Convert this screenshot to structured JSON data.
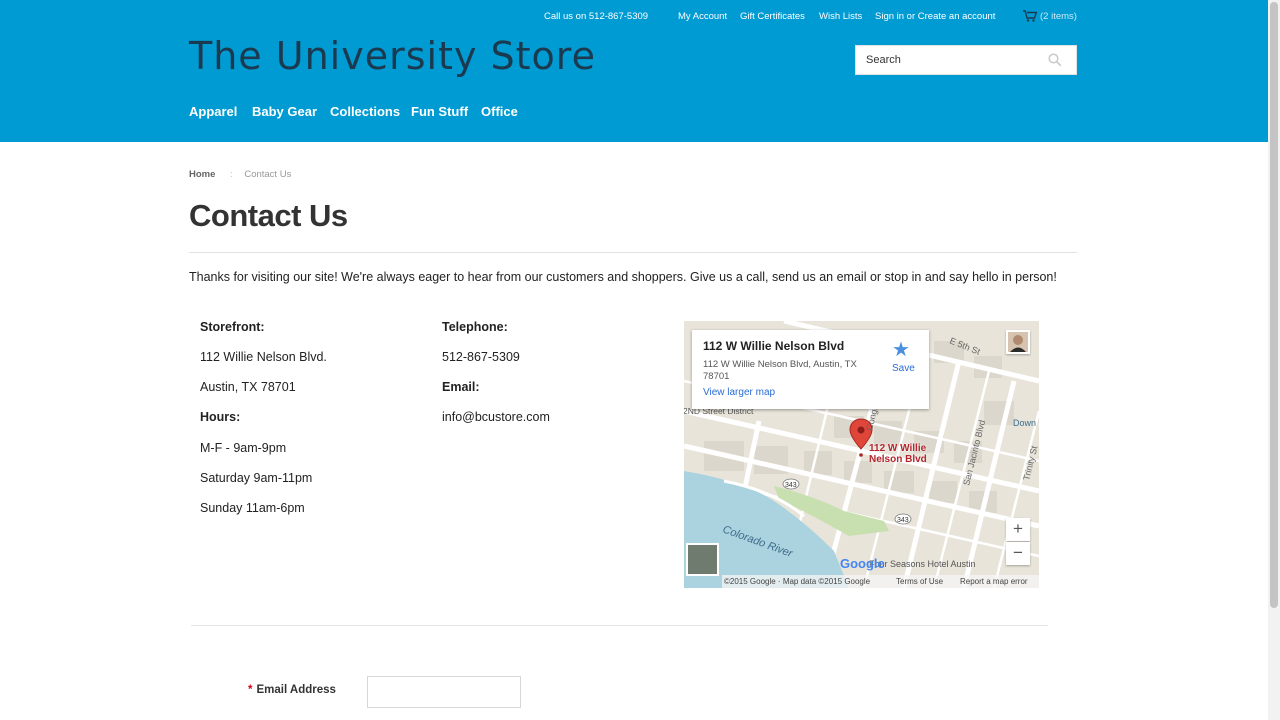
{
  "topbar": {
    "phone": "Call us on 512-867-5309",
    "my_account": "My Account",
    "gift_certificates": "Gift Certificates",
    "wish_lists": "Wish Lists",
    "sign_in": "Sign in or Create an account",
    "cart_count": "(2 items)"
  },
  "header": {
    "store_name": "The University Store",
    "search_placeholder": "Search"
  },
  "nav": [
    "Apparel",
    "Baby Gear",
    "Collections",
    "Fun Stuff",
    "Office"
  ],
  "breadcrumb": {
    "home": "Home",
    "separator": ":",
    "current": "Contact Us"
  },
  "page": {
    "title": "Contact Us",
    "intro": "Thanks for visiting our site! We're always eager to hear from our customers and shoppers. Give us a call, send us an email or stop in and say hello in person!"
  },
  "storefront": {
    "heading": "Storefront:",
    "address1": "112 Willie Nelson Blvd.",
    "address2": "Austin, TX 78701",
    "hours_heading": "Hours:",
    "hours": [
      "M-F - 9am-9pm",
      "Saturday 9am-11pm",
      "Sunday 11am-6pm"
    ]
  },
  "contact": {
    "telephone_heading": "Telephone:",
    "telephone": "512-867-5309",
    "email_heading": "Email:",
    "email": "info@bcustore.com"
  },
  "map": {
    "card_title": "112 W Willie Nelson Blvd",
    "card_address": "112 W Willie Nelson Blvd, Austin, TX 78701",
    "larger_map": "View larger map",
    "save": "Save",
    "marker_label": "112 W Willie Nelson Blvd",
    "zoom_in": "+",
    "zoom_out": "−",
    "labels": {
      "e5th": "E 5th St",
      "congress": "Congress",
      "san_jacinto": "San Jacinto Blvd",
      "trinity": "Trinity St",
      "colorado": "Colorado River",
      "district": "2ND Street District",
      "downtown": "Down",
      "four_seasons": "Four Seasons Hotel Austin",
      "shield1": "343",
      "shield2": "343"
    },
    "footer_copyright": "©2015 Google · Map data ©2015 Google",
    "footer_terms": "Terms of Use",
    "footer_report": "Report a map error",
    "google": "Google"
  },
  "form": {
    "required_mark": "*",
    "email_label": "Email Address",
    "email_value": ""
  },
  "colors": {
    "header_bg": "#009bd3",
    "title_text": "#1b3a4f",
    "link_blue": "#2a6dd4",
    "required_red": "#d0021b"
  }
}
